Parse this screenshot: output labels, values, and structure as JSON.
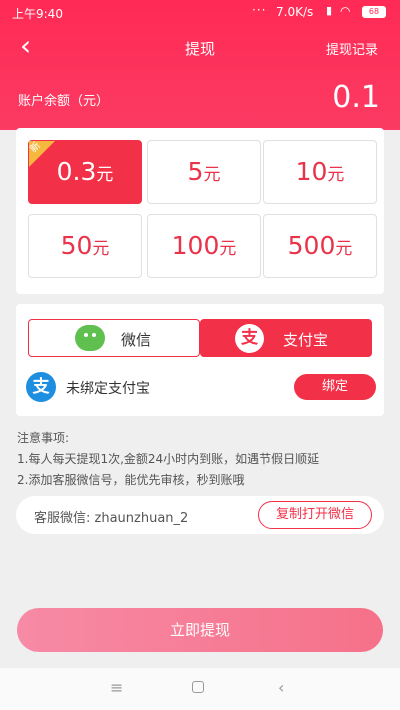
{
  "status_bar": {
    "time": "上午9:40",
    "dots": "···",
    "speed": "7.0K/s",
    "battery": "68"
  },
  "nav": {
    "back_icon": "‹",
    "title": "提现",
    "record": "提现记录"
  },
  "balance": {
    "label": "账户余额（元）",
    "value": "0.1"
  },
  "amounts": {
    "badge": "新",
    "unit": "元",
    "items": [
      {
        "value": "0.3"
      },
      {
        "value": "5"
      },
      {
        "value": "10"
      },
      {
        "value": "50"
      },
      {
        "value": "100"
      },
      {
        "value": "500"
      }
    ],
    "selected_index": 0
  },
  "payment": {
    "wechat_label": "微信",
    "alipay_label": "支付宝",
    "alipay_glyph": "支",
    "selected": "alipay",
    "bind_glyph": "支",
    "bind_text": "未绑定支付宝",
    "bind_button": "绑定"
  },
  "notes": {
    "title": "注意事项:",
    "lines": [
      "1.每人每天提现1次,金额24小时内到账，如遇节假日顺延",
      "2.添加客服微信号，能优先审核，秒到账哦"
    ]
  },
  "service": {
    "label": "客服微信: zhaunzhuan_2",
    "copy_button": "复制打开微信"
  },
  "submit": {
    "label": "立即提现"
  },
  "icons": {
    "back": "chevron-left-icon",
    "wechat": "wechat-icon",
    "alipay": "alipay-icon",
    "menu": "menu-icon",
    "home": "home-icon",
    "nav_back": "back-icon"
  },
  "colors": {
    "primary": "#f23048",
    "header": "#ff2a55",
    "badge": "#f5b73d",
    "alipay_blue": "#1e8fe0",
    "wechat_green": "#5fbf4f"
  }
}
